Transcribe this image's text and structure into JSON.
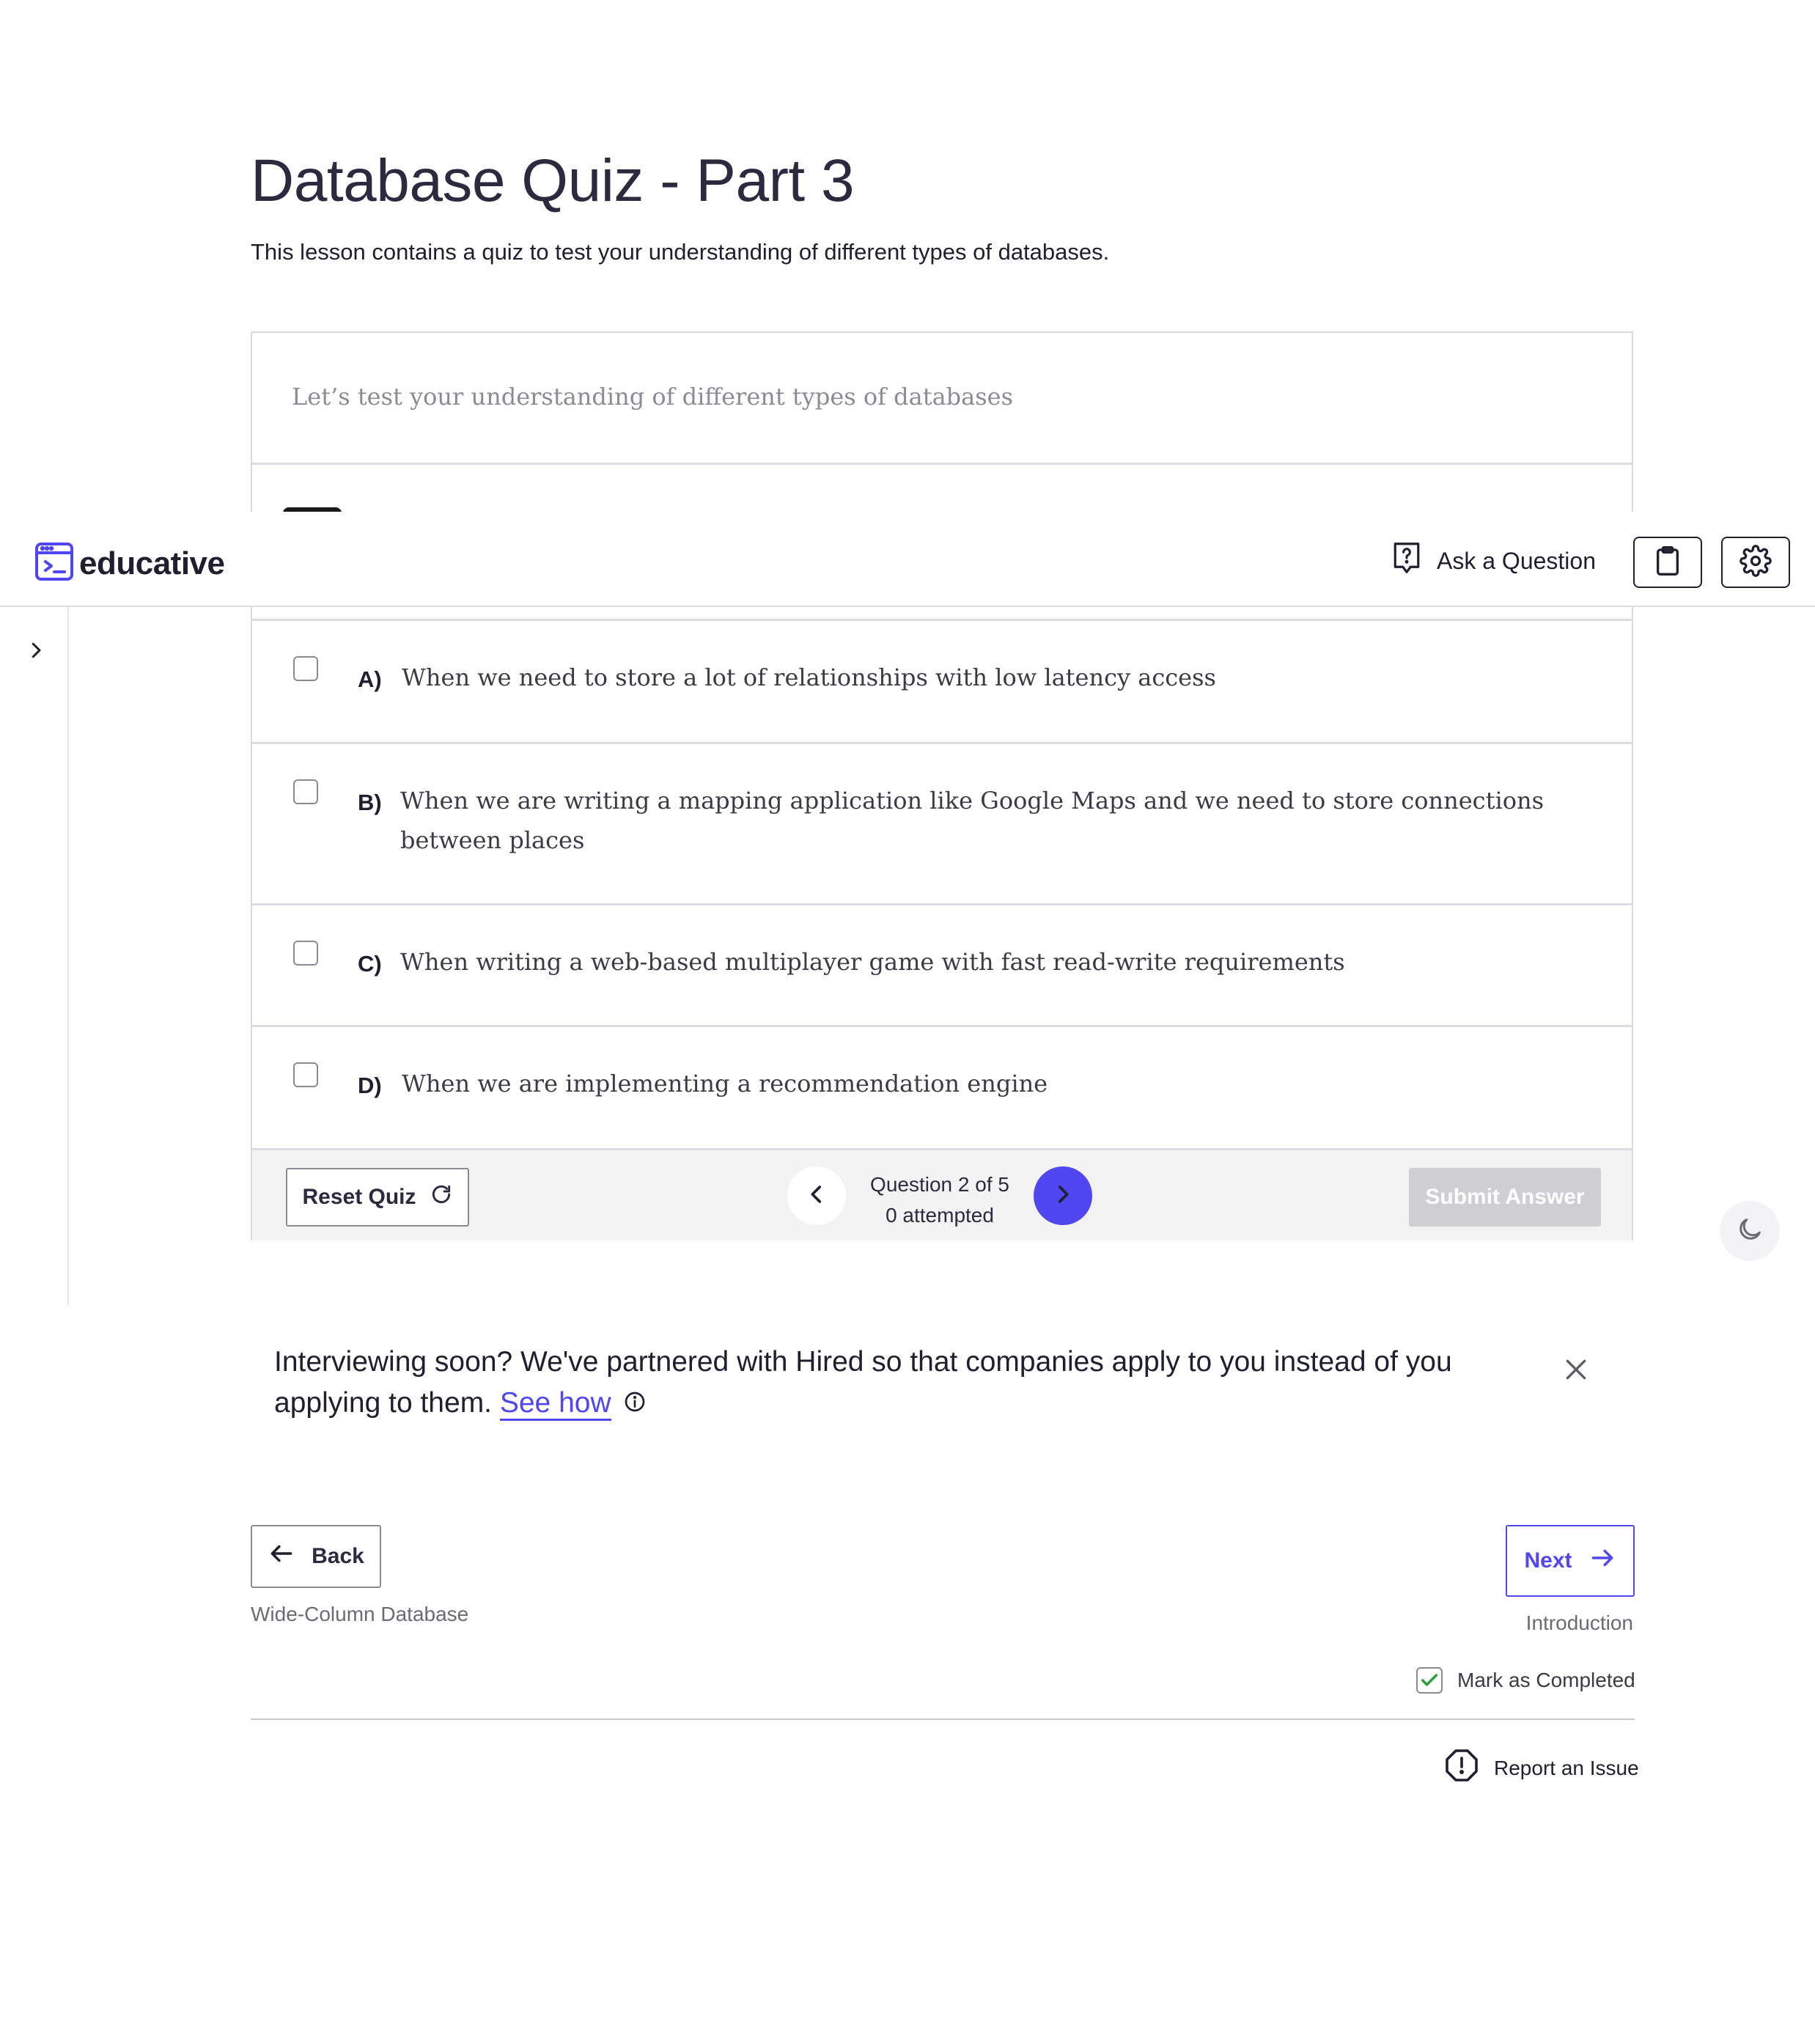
{
  "lesson": {
    "title": "Database Quiz - Part 3",
    "description": "This lesson contains a quiz to test your understanding of different types of databases."
  },
  "quiz": {
    "intro": "Let’s test your understanding of different types of databases",
    "options": [
      {
        "letter": "A)",
        "text": "When we need to store a lot of relationships with low latency access"
      },
      {
        "letter": "B)",
        "text": "When we are writing a mapping application like Google Maps and we need to store connections between places"
      },
      {
        "letter": "C)",
        "text": "When writing a web-based multiplayer game with fast read-write requirements"
      },
      {
        "letter": "D)",
        "text": "When we are implementing a recommendation engine"
      }
    ],
    "reset_label": "Reset Quiz",
    "question_counter": "Question 2 of 5",
    "attempted": "0 attempted",
    "submit_label": "Submit Answer"
  },
  "header": {
    "logo_text": "educative",
    "ask_label": "Ask a Question"
  },
  "promo": {
    "text": "Interviewing soon? We've partnered with Hired so that companies apply to you instead of you applying to them.",
    "link_label": "See how"
  },
  "navigation": {
    "back_label": "Back",
    "back_lesson": "Wide-Column Database",
    "next_label": "Next",
    "next_lesson": "Introduction",
    "mark_completed_label": "Mark as Completed",
    "mark_completed": true,
    "report_label": "Report an Issue"
  },
  "colors": {
    "accent": "#5046f2",
    "check": "#2e9e3a"
  }
}
